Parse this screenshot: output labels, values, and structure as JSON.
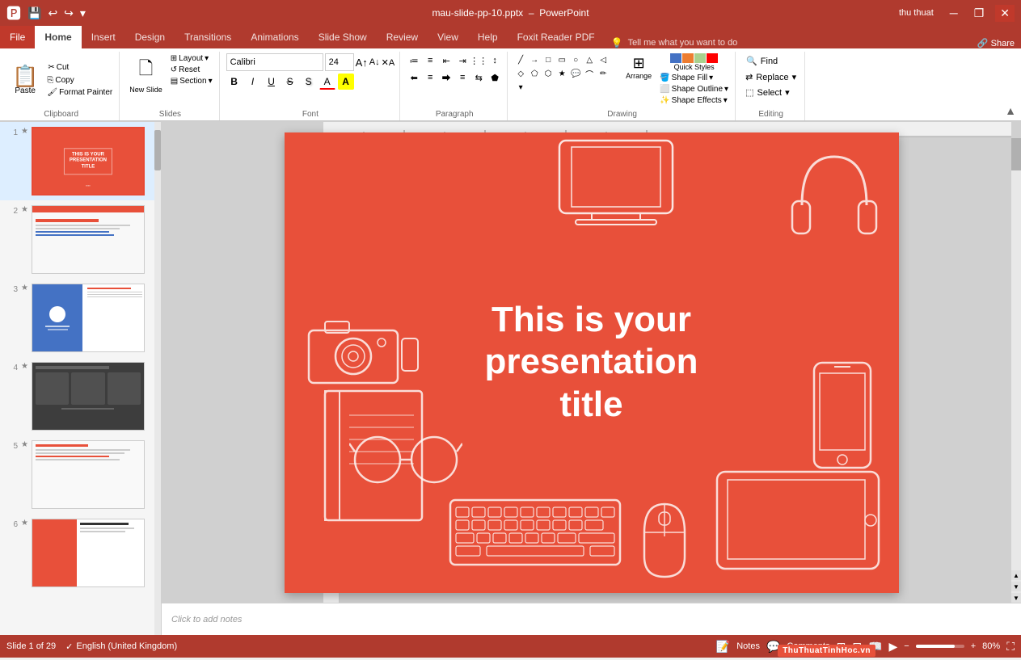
{
  "titleBar": {
    "filename": "mau-slide-pp-10.pptx",
    "appName": "PowerPoint",
    "username": "thu thuat",
    "minBtn": "─",
    "restoreBtn": "❐",
    "closeBtn": "✕",
    "saveIcon": "💾",
    "undoIcon": "↩",
    "redoIcon": "↪",
    "customizeIcon": "▾"
  },
  "tabs": {
    "file": "File",
    "home": "Home",
    "insert": "Insert",
    "design": "Design",
    "transitions": "Transitions",
    "animations": "Animations",
    "slideShow": "Slide Show",
    "review": "Review",
    "view": "View",
    "help": "Help",
    "foxitReader": "Foxit Reader PDF"
  },
  "ribbon": {
    "clipboard": {
      "label": "Clipboard",
      "paste": "Paste",
      "cut": "Cut",
      "copy": "Copy",
      "formatPainter": "Format Painter"
    },
    "slides": {
      "label": "Slides",
      "newSlide": "New Slide",
      "layout": "Layout",
      "reset": "Reset",
      "section": "Section"
    },
    "font": {
      "label": "Font",
      "fontName": "Calibri",
      "fontSize": "24",
      "increaseFontSize": "A",
      "decreaseFontSize": "A",
      "clearFormatting": "✕",
      "bold": "B",
      "italic": "I",
      "underline": "U",
      "strikethrough": "S",
      "shadow": "S",
      "fontColor": "A",
      "textHighlight": "A"
    },
    "paragraph": {
      "label": "Paragraph",
      "bulletList": "≡",
      "numberedList": "≡",
      "decreaseIndent": "⇤",
      "increaseIndent": "⇥",
      "lineSpacing": "↕",
      "alignLeft": "≡",
      "alignCenter": "≡",
      "alignRight": "≡",
      "justify": "≡",
      "columns": "⊞",
      "textDirection": "⇆",
      "convertToSmartArt": "⬟"
    },
    "drawing": {
      "label": "Drawing",
      "shapeFill": "Shape Fill",
      "shapeOutline": "Shape Outline",
      "shapeEffects": "Shape Effects",
      "arrange": "Arrange",
      "quickStyles": "Quick Styles"
    },
    "editing": {
      "label": "Editing",
      "find": "Find",
      "replace": "Replace",
      "select": "Select"
    }
  },
  "slides": [
    {
      "num": "1",
      "star": "★",
      "type": "red-title",
      "active": true
    },
    {
      "num": "2",
      "star": "★",
      "type": "content",
      "active": false
    },
    {
      "num": "3",
      "star": "★",
      "type": "profile",
      "active": false
    },
    {
      "num": "4",
      "star": "★",
      "type": "dark",
      "active": false
    },
    {
      "num": "5",
      "star": "★",
      "type": "light",
      "active": false
    },
    {
      "num": "6",
      "star": "★",
      "type": "white",
      "active": false
    }
  ],
  "mainSlide": {
    "titleLine1": "This is your",
    "titleLine2": "presentation",
    "titleLine3": "title"
  },
  "notesBar": {
    "placeholder": "Click to add notes"
  },
  "statusBar": {
    "slideInfo": "Slide 1 of 29",
    "language": "English (United Kingdom)",
    "notesBtn": "Notes",
    "commentsBtn": "Comments",
    "zoomLevel": "80%",
    "normalView": "⊞",
    "slidesorter": "⊟",
    "readingView": "📖",
    "slideshow": "▶"
  },
  "tellMe": {
    "placeholder": "Tell me what you want to do"
  }
}
